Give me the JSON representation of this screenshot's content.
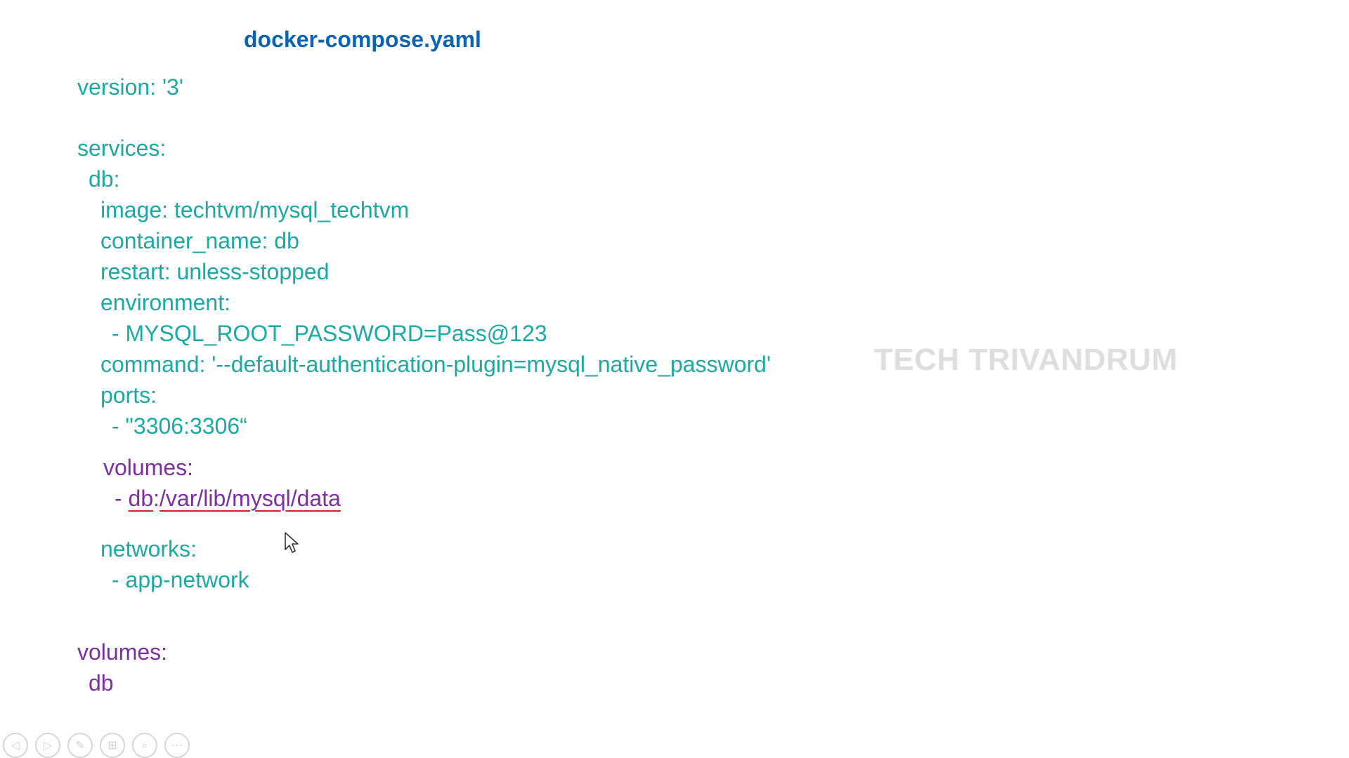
{
  "title": "docker-compose.yaml",
  "watermark": "TECH TRIVANDRUM",
  "colors": {
    "title": "#0b63b5",
    "code_teal": "#1aa9a3",
    "code_purple": "#7b2fa0",
    "underline_red": "#d8202a"
  },
  "code": {
    "version": "version: '3'",
    "services": "services:",
    "db": "db:",
    "image": "image: techtvm/mysql_techtvm",
    "container_name": "container_name: db",
    "restart": "restart: unless-stopped",
    "environment": "environment:",
    "env_item": "- MYSQL_ROOT_PASSWORD=Pass@123",
    "command": "command: '--default-authentication-plugin=mysql_native_password'",
    "ports": "ports:",
    "port_item": "- \"3306:3306“",
    "volumes": "volumes:",
    "volume_dash": "- ",
    "volume_name": "db",
    "volume_colon": ":",
    "volume_path": "/var/lib/mysql/data",
    "networks": "networks:",
    "network_item": "- app-network",
    "top_volumes": "volumes:",
    "top_volume_item": "db"
  },
  "controls": [
    {
      "name": "previous-slide",
      "glyph": "◁"
    },
    {
      "name": "next-slide",
      "glyph": "▷"
    },
    {
      "name": "pen",
      "glyph": "✎"
    },
    {
      "name": "slides-grid",
      "glyph": "⊞"
    },
    {
      "name": "zoom",
      "glyph": "⌕"
    },
    {
      "name": "more-options",
      "glyph": "⋯"
    }
  ]
}
